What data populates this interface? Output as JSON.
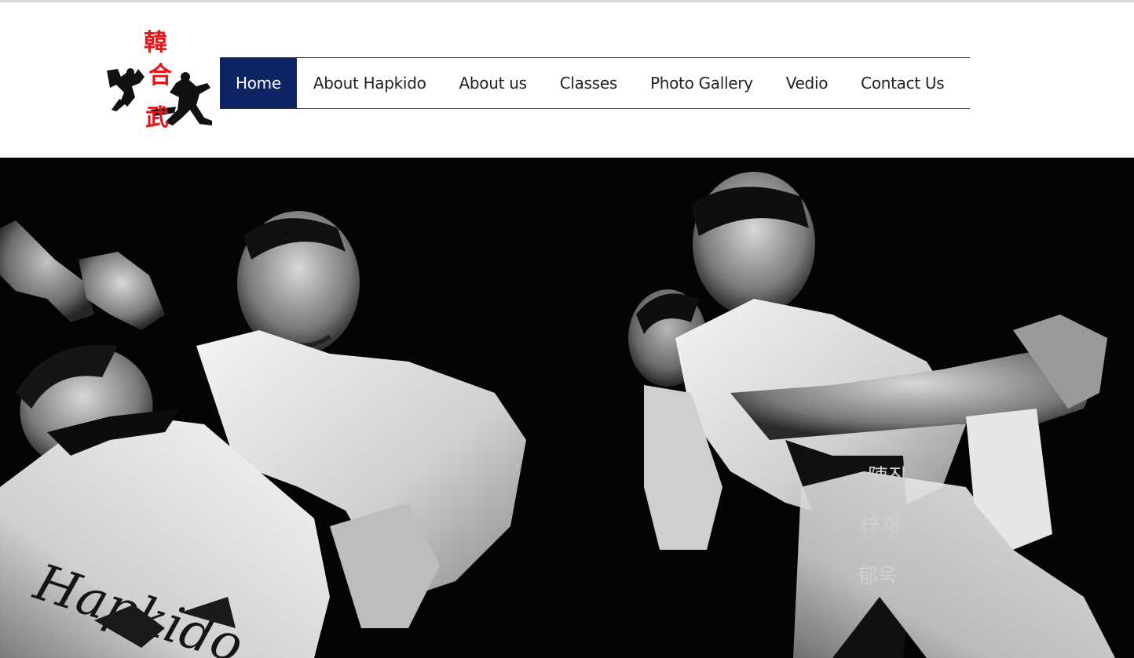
{
  "logo": {
    "characters": [
      "韓",
      "合",
      "武"
    ],
    "accent_color": "#e8161b"
  },
  "nav": {
    "active_color": "#0f2465",
    "items": [
      {
        "label": "Home",
        "active": true
      },
      {
        "label": "About Hapkido",
        "active": false
      },
      {
        "label": "About us",
        "active": false
      },
      {
        "label": "Classes",
        "active": false
      },
      {
        "label": "Photo Gallery",
        "active": false
      },
      {
        "label": "Vedio",
        "active": false
      },
      {
        "label": "Contact Us",
        "active": false
      }
    ]
  },
  "hero": {
    "uniform_text": "Hapkido",
    "belt_text": [
      "陳진",
      "梓재",
      "郁욱"
    ]
  }
}
